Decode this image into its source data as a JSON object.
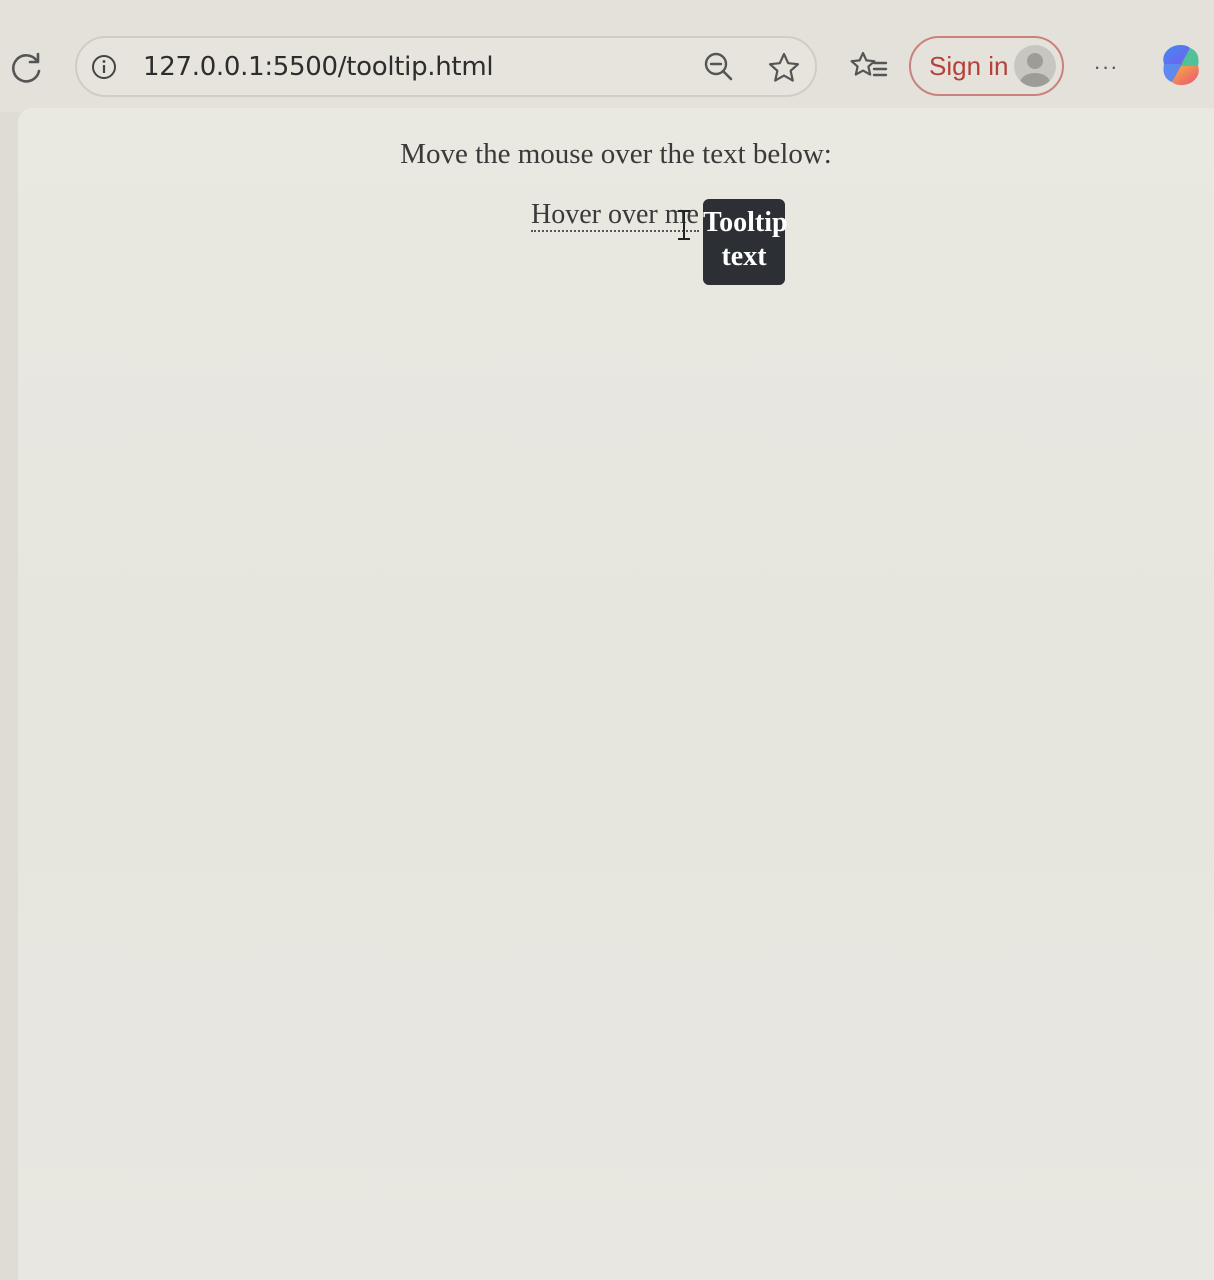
{
  "browser": {
    "address_bar": {
      "url": "127.0.0.1:5500/tooltip.html",
      "site_info_icon": "info-icon",
      "zoom_icon": "zoom-out-icon",
      "favorite_icon": "star-icon"
    },
    "toolbar": {
      "reload_icon": "reload-icon",
      "favorites_icon": "favorites-list-icon",
      "signin_label": "Sign in",
      "more_label": "···",
      "copilot_icon": "copilot-icon"
    },
    "colors": {
      "signin_accent": "#b4413a",
      "tooltip_bg": "#2c3034"
    }
  },
  "page": {
    "prompt": "Move the mouse over the text below:",
    "hover_text": "Hover over me",
    "tooltip_line1": "Tooltip",
    "tooltip_line2": "text"
  }
}
